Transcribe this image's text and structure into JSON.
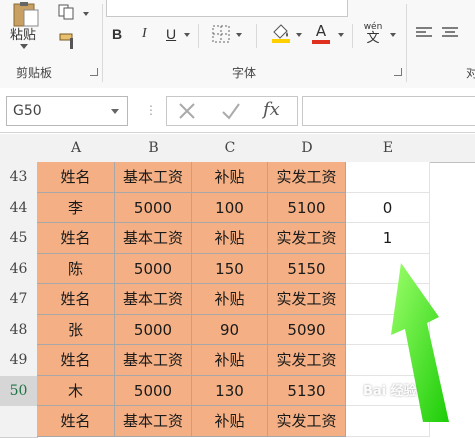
{
  "ribbon": {
    "clipboard": {
      "paste_label": "粘贴",
      "group_label": "剪贴板"
    },
    "font": {
      "group_label": "字体",
      "bold_label": "B",
      "italic_label": "I",
      "underline_label": "U",
      "wen_label": "wén",
      "wen_char": "文",
      "font_color_letter": "A",
      "font_color_hex": "#e03020",
      "fill_color_hex": "#ffd000"
    },
    "partial_group_char": "对"
  },
  "formula_bar": {
    "name_box_value": "G50",
    "fx_label": "fx"
  },
  "sheet": {
    "columns": [
      "A",
      "B",
      "C",
      "D",
      "E"
    ],
    "rows": [
      {
        "num": "43",
        "cells": [
          "姓名",
          "基本工资",
          "补贴",
          "实发工资",
          ""
        ]
      },
      {
        "num": "44",
        "cells": [
          "李",
          "5000",
          "100",
          "5100",
          "0"
        ]
      },
      {
        "num": "45",
        "cells": [
          "姓名",
          "基本工资",
          "补贴",
          "实发工资",
          "1"
        ]
      },
      {
        "num": "46",
        "cells": [
          "陈",
          "5000",
          "150",
          "5150",
          ""
        ]
      },
      {
        "num": "47",
        "cells": [
          "姓名",
          "基本工资",
          "补贴",
          "实发工资",
          ""
        ]
      },
      {
        "num": "48",
        "cells": [
          "张",
          "5000",
          "90",
          "5090",
          ""
        ]
      },
      {
        "num": "49",
        "cells": [
          "姓名",
          "基本工资",
          "补贴",
          "实发工资",
          ""
        ]
      },
      {
        "num": "50",
        "cells": [
          "木",
          "5000",
          "130",
          "5130",
          ""
        ]
      },
      {
        "num": "",
        "cells": [
          "姓名",
          "基本工资",
          "补贴",
          "实发工资",
          ""
        ]
      }
    ],
    "highlight_fill": "#f4b084",
    "arrow_color": "#33dd11"
  },
  "watermark": {
    "text": "Bai 经验"
  }
}
